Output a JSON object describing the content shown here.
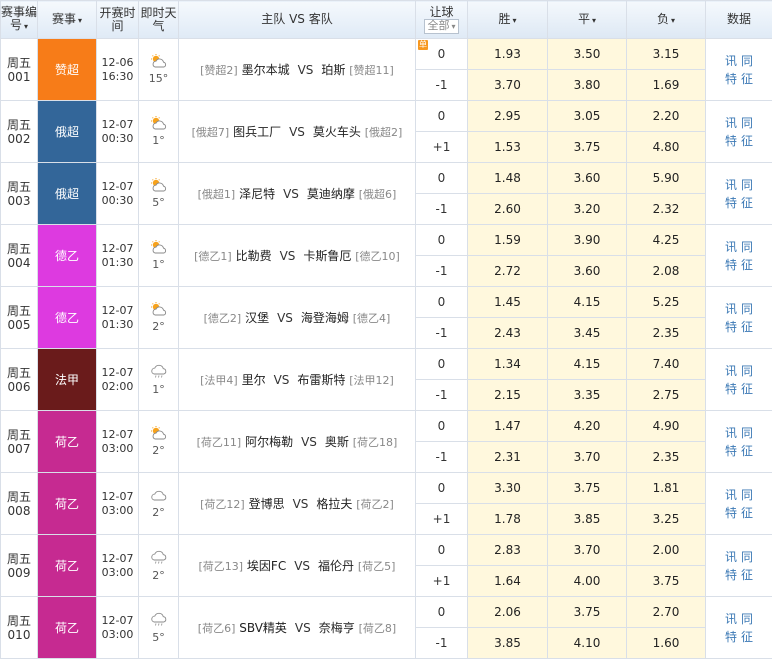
{
  "header": {
    "col_num": "赛事编号",
    "col_league": "赛事",
    "col_time": "开赛时间",
    "col_weather": "即时天气",
    "col_teams": "主队 VS 客队",
    "col_handicap": "让球",
    "handicap_select": "全部",
    "col_win": "胜",
    "col_draw": "平",
    "col_lose": "负",
    "col_data": "数据"
  },
  "colors": {
    "league_赞超": "#f77c18",
    "league_俄超": "#336699",
    "league_德乙": "#dd3ae0",
    "league_法甲": "#6a1b1b",
    "league_荷乙": "#c62a91",
    "odds_bg": "#fff8dd",
    "link": "#3c79b5"
  },
  "matches": [
    {
      "day": "周五",
      "num": "001",
      "league": "赞超",
      "league_color": "#f77c18",
      "date": "12-06",
      "time": "16:30",
      "weather_icon": "partly-sunny-icon",
      "temp": "15°",
      "home_rank": "[赞超2]",
      "home": "墨尔本城",
      "away": "珀斯",
      "away_rank": "[赞超11]",
      "tag": "单",
      "hcp": [
        "0",
        "-1"
      ],
      "odds": [
        [
          "1.93",
          "3.50",
          "3.15"
        ],
        [
          "3.70",
          "3.80",
          "1.69"
        ]
      ],
      "links": [
        "讯",
        "同",
        "特",
        "征"
      ]
    },
    {
      "day": "周五",
      "num": "002",
      "league": "俄超",
      "league_color": "#336699",
      "date": "12-07",
      "time": "00:30",
      "weather_icon": "partly-sunny-icon",
      "temp": "1°",
      "home_rank": "[俄超7]",
      "home": "图兵工厂",
      "away": "莫火车头",
      "away_rank": "[俄超2]",
      "tag": "",
      "hcp": [
        "0",
        "+1"
      ],
      "odds": [
        [
          "2.95",
          "3.05",
          "2.20"
        ],
        [
          "1.53",
          "3.75",
          "4.80"
        ]
      ],
      "links": [
        "讯",
        "同",
        "特",
        "征"
      ]
    },
    {
      "day": "周五",
      "num": "003",
      "league": "俄超",
      "league_color": "#336699",
      "date": "12-07",
      "time": "00:30",
      "weather_icon": "partly-sunny-icon",
      "temp": "5°",
      "home_rank": "[俄超1]",
      "home": "泽尼特",
      "away": "莫迪纳摩",
      "away_rank": "[俄超6]",
      "tag": "",
      "hcp": [
        "0",
        "-1"
      ],
      "odds": [
        [
          "1.48",
          "3.60",
          "5.90"
        ],
        [
          "2.60",
          "3.20",
          "2.32"
        ]
      ],
      "links": [
        "讯",
        "同",
        "特",
        "征"
      ]
    },
    {
      "day": "周五",
      "num": "004",
      "league": "德乙",
      "league_color": "#dd3ae0",
      "date": "12-07",
      "time": "01:30",
      "weather_icon": "partly-sunny-icon",
      "temp": "1°",
      "home_rank": "[德乙1]",
      "home": "比勒费",
      "away": "卡斯鲁厄",
      "away_rank": "[德乙10]",
      "tag": "",
      "hcp": [
        "0",
        "-1"
      ],
      "odds": [
        [
          "1.59",
          "3.90",
          "4.25"
        ],
        [
          "2.72",
          "3.60",
          "2.08"
        ]
      ],
      "links": [
        "讯",
        "同",
        "特",
        "征"
      ]
    },
    {
      "day": "周五",
      "num": "005",
      "league": "德乙",
      "league_color": "#dd3ae0",
      "date": "12-07",
      "time": "01:30",
      "weather_icon": "partly-sunny-icon",
      "temp": "2°",
      "home_rank": "[德乙2]",
      "home": "汉堡",
      "away": "海登海姆",
      "away_rank": "[德乙4]",
      "tag": "",
      "hcp": [
        "0",
        "-1"
      ],
      "odds": [
        [
          "1.45",
          "4.15",
          "5.25"
        ],
        [
          "2.43",
          "3.45",
          "2.35"
        ]
      ],
      "links": [
        "讯",
        "同",
        "特",
        "征"
      ]
    },
    {
      "day": "周五",
      "num": "006",
      "league": "法甲",
      "league_color": "#6a1b1b",
      "date": "12-07",
      "time": "02:00",
      "weather_icon": "rain-cloud-icon",
      "temp": "1°",
      "home_rank": "[法甲4]",
      "home": "里尔",
      "away": "布雷斯特",
      "away_rank": "[法甲12]",
      "tag": "",
      "hcp": [
        "0",
        "-1"
      ],
      "odds": [
        [
          "1.34",
          "4.15",
          "7.40"
        ],
        [
          "2.15",
          "3.35",
          "2.75"
        ]
      ],
      "links": [
        "讯",
        "同",
        "特",
        "征"
      ]
    },
    {
      "day": "周五",
      "num": "007",
      "league": "荷乙",
      "league_color": "#c62a91",
      "date": "12-07",
      "time": "03:00",
      "weather_icon": "partly-sunny-icon",
      "temp": "2°",
      "home_rank": "[荷乙11]",
      "home": "阿尔梅勒",
      "away": "奥斯",
      "away_rank": "[荷乙18]",
      "tag": "",
      "hcp": [
        "0",
        "-1"
      ],
      "odds": [
        [
          "1.47",
          "4.20",
          "4.90"
        ],
        [
          "2.31",
          "3.70",
          "2.35"
        ]
      ],
      "links": [
        "讯",
        "同",
        "特",
        "征"
      ]
    },
    {
      "day": "周五",
      "num": "008",
      "league": "荷乙",
      "league_color": "#c62a91",
      "date": "12-07",
      "time": "03:00",
      "weather_icon": "cloud-icon",
      "temp": "2°",
      "home_rank": "[荷乙12]",
      "home": "登博思",
      "away": "格拉夫",
      "away_rank": "[荷乙2]",
      "tag": "",
      "hcp": [
        "0",
        "+1"
      ],
      "odds": [
        [
          "3.30",
          "3.75",
          "1.81"
        ],
        [
          "1.78",
          "3.85",
          "3.25"
        ]
      ],
      "links": [
        "讯",
        "同",
        "特",
        "征"
      ]
    },
    {
      "day": "周五",
      "num": "009",
      "league": "荷乙",
      "league_color": "#c62a91",
      "date": "12-07",
      "time": "03:00",
      "weather_icon": "rain-cloud-icon",
      "temp": "2°",
      "home_rank": "[荷乙13]",
      "home": "埃因FC",
      "away": "福伦丹",
      "away_rank": "[荷乙5]",
      "tag": "",
      "hcp": [
        "0",
        "+1"
      ],
      "odds": [
        [
          "2.83",
          "3.70",
          "2.00"
        ],
        [
          "1.64",
          "4.00",
          "3.75"
        ]
      ],
      "links": [
        "讯",
        "同",
        "特",
        "征"
      ]
    },
    {
      "day": "周五",
      "num": "010",
      "league": "荷乙",
      "league_color": "#c62a91",
      "date": "12-07",
      "time": "03:00",
      "weather_icon": "rain-cloud-icon",
      "temp": "5°",
      "home_rank": "[荷乙6]",
      "home": "SBV精英",
      "away": "奈梅亨",
      "away_rank": "[荷乙8]",
      "tag": "",
      "hcp": [
        "0",
        "-1"
      ],
      "odds": [
        [
          "2.06",
          "3.75",
          "2.70"
        ],
        [
          "3.85",
          "4.10",
          "1.60"
        ]
      ],
      "links": [
        "讯",
        "同",
        "特",
        "征"
      ]
    }
  ]
}
